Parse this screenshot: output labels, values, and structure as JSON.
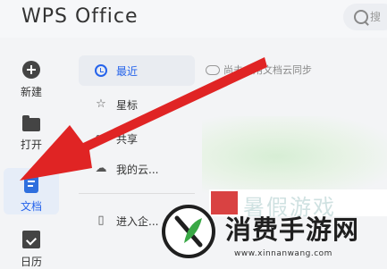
{
  "app": {
    "title": "WPS Office"
  },
  "search": {
    "placeholder": "搜"
  },
  "leftnav": {
    "items": [
      {
        "label": "新建",
        "icon": "circle-plus-icon"
      },
      {
        "label": "打开",
        "icon": "folder-icon"
      },
      {
        "label": "文档",
        "icon": "document-icon",
        "active": true
      },
      {
        "label": "日历",
        "icon": "calendar-icon"
      }
    ]
  },
  "midpanel": {
    "items": [
      {
        "label": "最近",
        "icon": "clock-icon",
        "active": true
      },
      {
        "label": "星标",
        "icon": "star-icon"
      },
      {
        "label": "共享",
        "icon": "share-icon"
      },
      {
        "label": "我的云...",
        "icon": "cloud-icon"
      },
      {
        "label": "进入企...",
        "icon": "building-icon"
      }
    ]
  },
  "content": {
    "cloud_sync_note": "尚未启用文档云同步"
  },
  "overlay": {
    "arrow_color": "#e02424"
  },
  "watermark": {
    "faded_text": "暑假游戏",
    "text": "消费手游网",
    "url": "www.xinnanwang.com"
  },
  "colors": {
    "accent": "#2563eb",
    "arrow": "#e02424"
  }
}
